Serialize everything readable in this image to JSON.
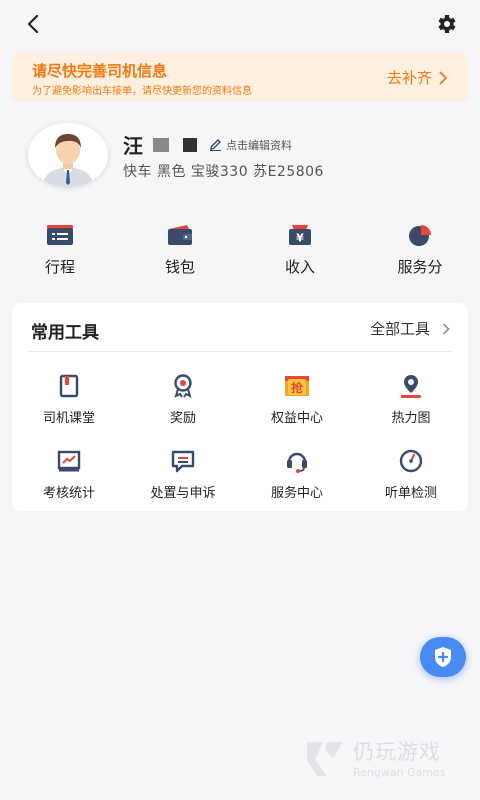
{
  "banner": {
    "title": "请尽快完善司机信息",
    "subtitle": "为了避免影响出车接单，请尽快更新您的资料信息",
    "action_label": "去补齐"
  },
  "profile": {
    "name": "汪",
    "edit_label": "点击编辑资料",
    "car_info": "快车 黑色 宝骏330  苏E25806"
  },
  "quick_nav": [
    {
      "label": "行程",
      "icon": "itinerary-icon"
    },
    {
      "label": "钱包",
      "icon": "wallet-icon"
    },
    {
      "label": "收入",
      "icon": "income-icon"
    },
    {
      "label": "服务分",
      "icon": "service-score-icon"
    }
  ],
  "tools": {
    "title": "常用工具",
    "all_label": "全部工具",
    "items": [
      {
        "label": "司机课堂",
        "icon": "classroom-icon"
      },
      {
        "label": "奖励",
        "icon": "reward-icon"
      },
      {
        "label": "权益中心",
        "icon": "benefits-icon",
        "glyph": "抢"
      },
      {
        "label": "热力图",
        "icon": "heatmap-icon"
      },
      {
        "label": "考核统计",
        "icon": "assessment-stats-icon"
      },
      {
        "label": "处置与申诉",
        "icon": "appeal-icon"
      },
      {
        "label": "服务中心",
        "icon": "service-center-icon"
      },
      {
        "label": "听单检测",
        "icon": "order-listening-check-icon"
      }
    ]
  },
  "watermark": {
    "text": "仍玩游戏",
    "subtext": "Rengwan Games"
  },
  "colors": {
    "accent_orange": "#f07a12",
    "banner_bg": "#fdf0e0",
    "icon_navy": "#3a4a6b",
    "icon_red": "#e8443a",
    "fab_blue": "#4a8af4"
  }
}
